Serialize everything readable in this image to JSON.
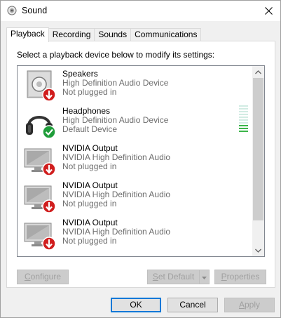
{
  "window": {
    "title": "Sound",
    "close_icon": "close-icon"
  },
  "tabs": [
    {
      "label": "Playback",
      "active": true
    },
    {
      "label": "Recording",
      "active": false
    },
    {
      "label": "Sounds",
      "active": false
    },
    {
      "label": "Communications",
      "active": false
    }
  ],
  "instruction": "Select a playback device below to modify its settings:",
  "devices": [
    {
      "name": "Speakers",
      "driver": "High Definition Audio Device",
      "status": "Not plugged in",
      "icon": "speaker-icon",
      "badge": "unplugged-badge-icon"
    },
    {
      "name": "Headphones",
      "driver": "High Definition Audio Device",
      "status": "Default Device",
      "icon": "headphones-icon",
      "badge": "default-check-badge-icon"
    },
    {
      "name": "NVIDIA Output",
      "driver": "NVIDIA High Definition Audio",
      "status": "Not plugged in",
      "icon": "monitor-icon",
      "badge": "unplugged-badge-icon"
    },
    {
      "name": "NVIDIA Output",
      "driver": "NVIDIA High Definition Audio",
      "status": "Not plugged in",
      "icon": "monitor-icon",
      "badge": "unplugged-badge-icon"
    },
    {
      "name": "NVIDIA Output",
      "driver": "NVIDIA High Definition Audio",
      "status": "Not plugged in",
      "icon": "monitor-icon",
      "badge": "unplugged-badge-icon"
    }
  ],
  "headphones_level": {
    "active_bars": 3,
    "total_bars": 10
  },
  "panel_buttons": {
    "configure": {
      "prefix": "C",
      "rest": "onfigure",
      "enabled": false
    },
    "set_default": {
      "prefix": "S",
      "rest": "et Default",
      "enabled": false
    },
    "properties": {
      "prefix": "P",
      "rest": "roperties",
      "enabled": false
    }
  },
  "dialog_buttons": {
    "ok": "OK",
    "cancel": "Cancel",
    "apply": {
      "prefix": "A",
      "rest": "pply",
      "enabled": false
    }
  },
  "colors": {
    "badge_red": "#d01d1d",
    "badge_green": "#1f9d3a",
    "level_active": "#3cb54a",
    "level_inactive": "#d2ece3",
    "accent": "#0078d7"
  }
}
